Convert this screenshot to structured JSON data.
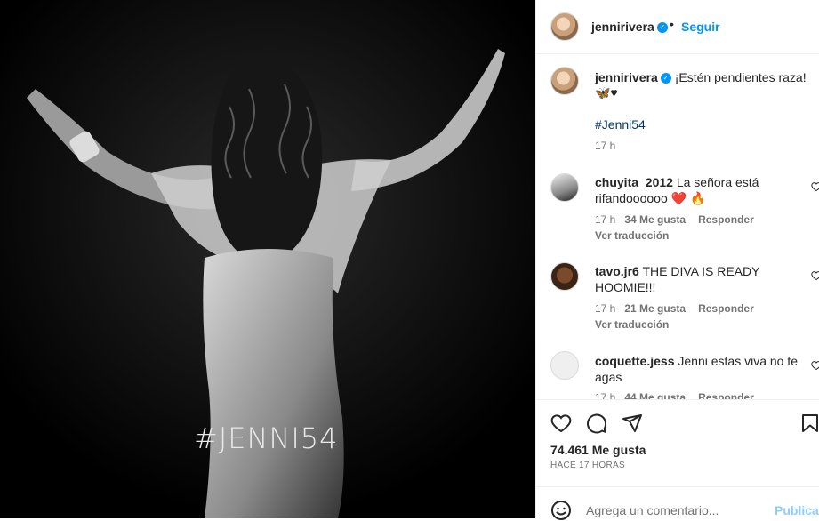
{
  "media": {
    "overlay_text": "#JENNI54"
  },
  "header": {
    "username": "jennirivera",
    "separator": "•",
    "follow_label": "Seguir"
  },
  "caption": {
    "username": "jennirivera",
    "text": "¡Estén pendientes raza!",
    "emoji": "🦋♥",
    "hashtag": "#Jenni54",
    "time": "17 h"
  },
  "comments": [
    {
      "username": "chuyita_2012",
      "text_line1": "La señora está",
      "text_line2": "rifandoooooo ❤️ 🔥",
      "time": "17 h",
      "likes": "34 Me gusta",
      "reply": "Responder",
      "translate": "Ver traducción"
    },
    {
      "username": "tavo.jr6",
      "text_line1": "THE DIVA IS READY",
      "text_line2": "HOOMIE!!!",
      "time": "17 h",
      "likes": "21 Me gusta",
      "reply": "Responder",
      "translate": "Ver traducción"
    },
    {
      "username": "coquette.jess",
      "text_line1": "Jenni estas viva no te",
      "text_line2": "agas",
      "time": "17 h",
      "likes": "44 Me gusta",
      "reply": "Responder"
    }
  ],
  "actions": {
    "likes": "74.461 Me gusta",
    "time_ago": "HACE 17 HORAS"
  },
  "add_comment": {
    "placeholder": "Agrega un comentario...",
    "publish_label": "Publicar"
  },
  "colors": {
    "accent": "#0095f6",
    "link": "#00376b",
    "muted": "#737373"
  }
}
